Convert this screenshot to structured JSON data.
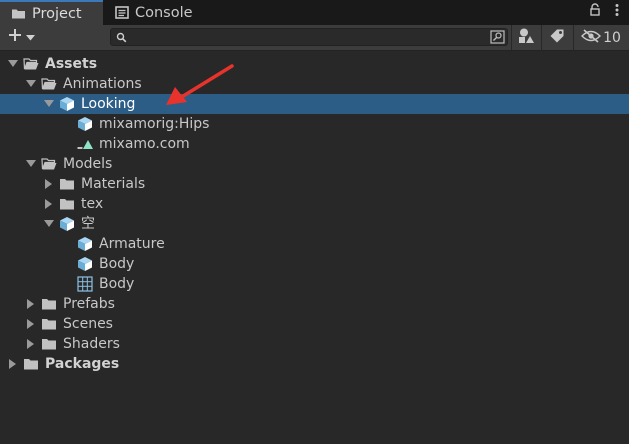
{
  "tabs": [
    {
      "label": "Project",
      "icon": "folder-icon",
      "active": true
    },
    {
      "label": "Console",
      "icon": "console-icon",
      "active": false
    }
  ],
  "tab_tools": {
    "lock_icon": "lock-icon",
    "menu_icon": "kebab-menu-icon"
  },
  "toolbar": {
    "create_icon": "plus-icon",
    "search_placeholder": "",
    "hidden_count": "10"
  },
  "tree": [
    {
      "label": "Assets",
      "depth": 0,
      "arrow": "down",
      "icon": "folder-open-icon",
      "bold": true
    },
    {
      "label": "Animations",
      "depth": 1,
      "arrow": "down",
      "icon": "folder-open-icon"
    },
    {
      "label": "Looking",
      "depth": 2,
      "arrow": "down",
      "icon": "prefab-icon",
      "selected": true
    },
    {
      "label": "mixamorig:Hips",
      "depth": 3,
      "arrow": "",
      "icon": "prefab-icon"
    },
    {
      "label": "mixamo.com",
      "depth": 3,
      "arrow": "",
      "icon": "animation-clip-icon"
    },
    {
      "label": "Models",
      "depth": 1,
      "arrow": "down",
      "icon": "folder-open-icon"
    },
    {
      "label": "Materials",
      "depth": 2,
      "arrow": "right",
      "icon": "folder-icon"
    },
    {
      "label": "tex",
      "depth": 2,
      "arrow": "right",
      "icon": "folder-icon"
    },
    {
      "label": "空",
      "depth": 2,
      "arrow": "down",
      "icon": "prefab-icon"
    },
    {
      "label": "Armature",
      "depth": 3,
      "arrow": "",
      "icon": "prefab-icon"
    },
    {
      "label": "Body",
      "depth": 3,
      "arrow": "",
      "icon": "prefab-icon"
    },
    {
      "label": "Body",
      "depth": 3,
      "arrow": "",
      "icon": "mesh-icon"
    },
    {
      "label": "Prefabs",
      "depth": 1,
      "arrow": "right",
      "icon": "folder-icon"
    },
    {
      "label": "Scenes",
      "depth": 1,
      "arrow": "right",
      "icon": "folder-icon"
    },
    {
      "label": "Shaders",
      "depth": 1,
      "arrow": "right",
      "icon": "folder-icon"
    },
    {
      "label": "Packages",
      "depth": 0,
      "arrow": "right",
      "icon": "folder-icon",
      "bold": true
    }
  ],
  "colors": {
    "accent": "#3a79bb",
    "selection": "#2c5d87",
    "annotation": "#e8332d",
    "prefab": "#8ac2e6"
  }
}
